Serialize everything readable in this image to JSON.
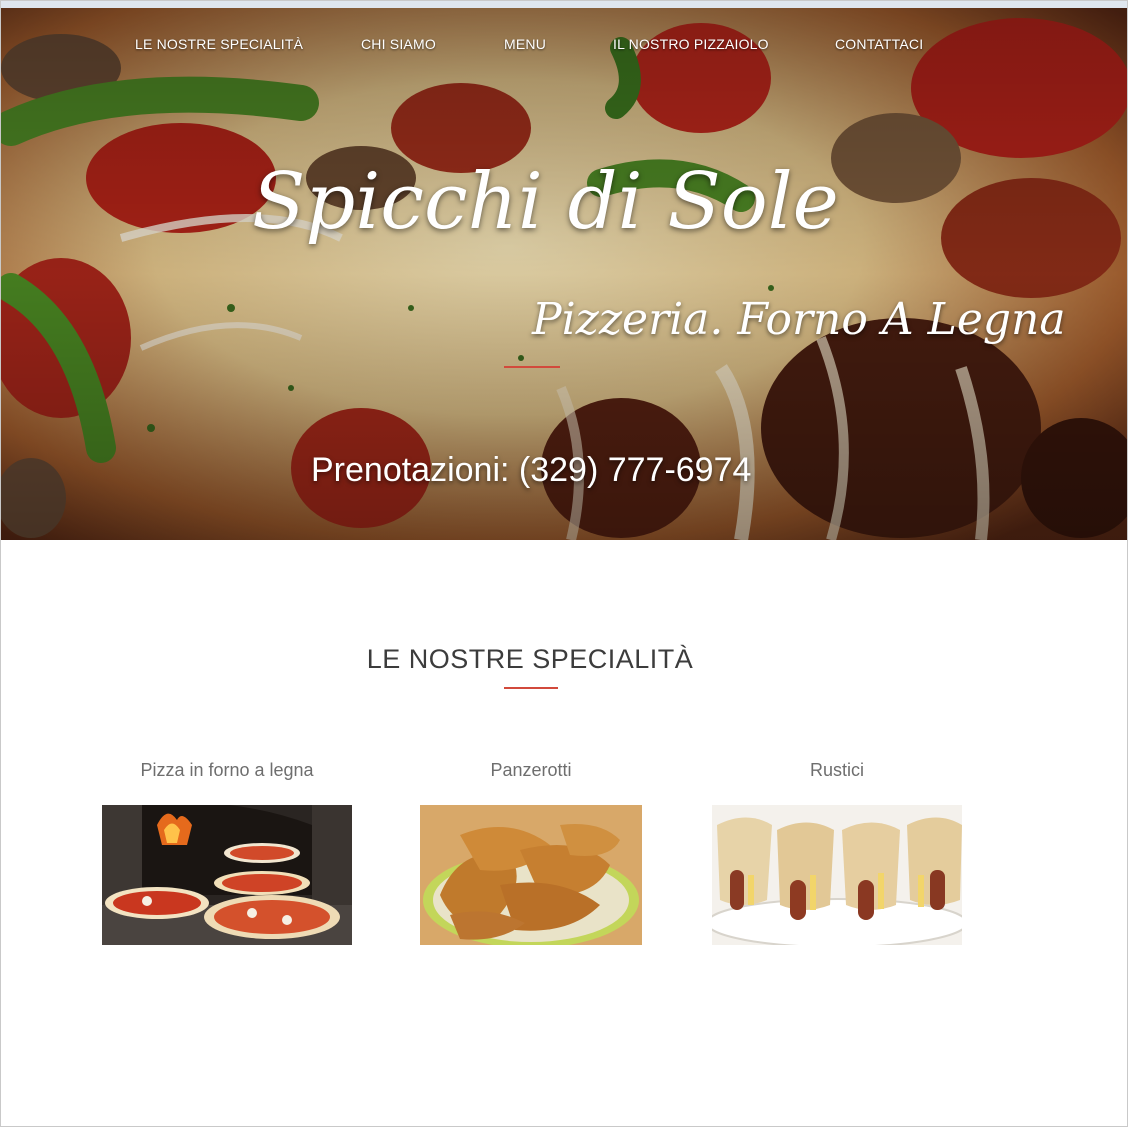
{
  "nav": {
    "items": [
      {
        "label": "LE NOSTRE SPECIALITÀ"
      },
      {
        "label": "CHI SIAMO"
      },
      {
        "label": "MENU"
      },
      {
        "label": "IL NOSTRO PIZZAIOLO"
      },
      {
        "label": "CONTATTACI"
      }
    ]
  },
  "hero": {
    "title": "Spicchi di Sole",
    "subtitle": "Pizzeria. Forno A Legna",
    "phone": "Prenotazioni: (329) 777-6974"
  },
  "specialties": {
    "title": "LE NOSTRE SPECIALITÀ",
    "items": [
      {
        "label": "Pizza in forno a legna",
        "image": "pizza-oven-photo"
      },
      {
        "label": "Panzerotti",
        "image": "panzerotti-photo"
      },
      {
        "label": "Rustici",
        "image": "rustici-photo"
      }
    ]
  },
  "colors": {
    "accent": "#d24a3c",
    "heading": "#3c3c3c",
    "muted": "#6e6e6e"
  }
}
